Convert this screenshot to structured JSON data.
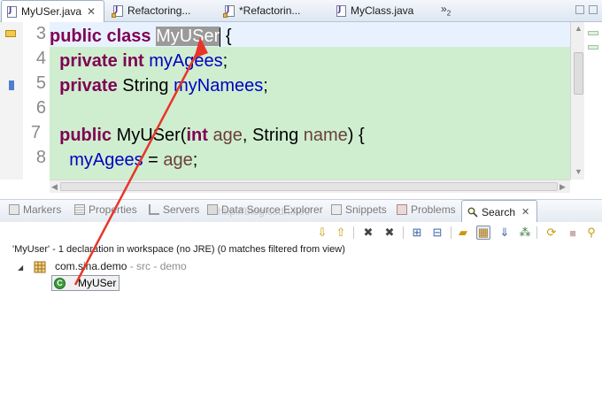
{
  "editor_tabs": [
    {
      "label": "MyUSer.java",
      "active": true,
      "close": "✕"
    },
    {
      "label": "Refactoring..."
    },
    {
      "label": "*Refactorin..."
    },
    {
      "label": "MyClass.java"
    }
  ],
  "tab_overflow": {
    "symbol": "»",
    "count": "2"
  },
  "editor": {
    "line_numbers": [
      "3",
      "4",
      "5",
      "6",
      "7",
      "8"
    ],
    "line3": {
      "kw": "public class",
      "selected": "MyUSer",
      "brace": " {"
    },
    "line4": {
      "kw": "private int",
      "field": "myAgees",
      "end": ";"
    },
    "line5": {
      "kw": "private",
      "type": "String",
      "field": "myNamees",
      "end": ";"
    },
    "line7": {
      "kw": "public",
      "name": "MyUSer(",
      "kw2": "int",
      "param1": "age",
      "mid": ", String ",
      "param2": "name",
      "end": ") {"
    },
    "line8": {
      "field": "myAgees",
      "mid": " = ",
      "param": "age",
      "end": ";"
    }
  },
  "views": {
    "tabs": [
      {
        "label": "Markers",
        "icon": "markers-icon"
      },
      {
        "label": "Properties",
        "icon": "properties-icon"
      },
      {
        "label": "Servers",
        "icon": "servers-icon"
      },
      {
        "label": "Data Source Explorer",
        "icon": "data-source-icon"
      },
      {
        "label": "Snippets",
        "icon": "snippets-icon"
      },
      {
        "label": "Problems",
        "icon": "problems-icon"
      },
      {
        "label": "Search",
        "icon": "search-icon",
        "active": true
      }
    ],
    "search_close": "✕"
  },
  "search": {
    "summary": "'MyUser' - 1 declaration in workspace (no JRE) (0 matches filtered from view)",
    "package": "com.sina.demo",
    "package_location": " - src - demo",
    "result": "MyUSer",
    "class_glyph": "C"
  },
  "watermark": "http://blog.csdn.net/",
  "colors": {
    "keyword": "#7f0055",
    "field": "#0000c0",
    "highlight_bg": "#cfeecf",
    "annotation_arrow": "#e8352a"
  }
}
